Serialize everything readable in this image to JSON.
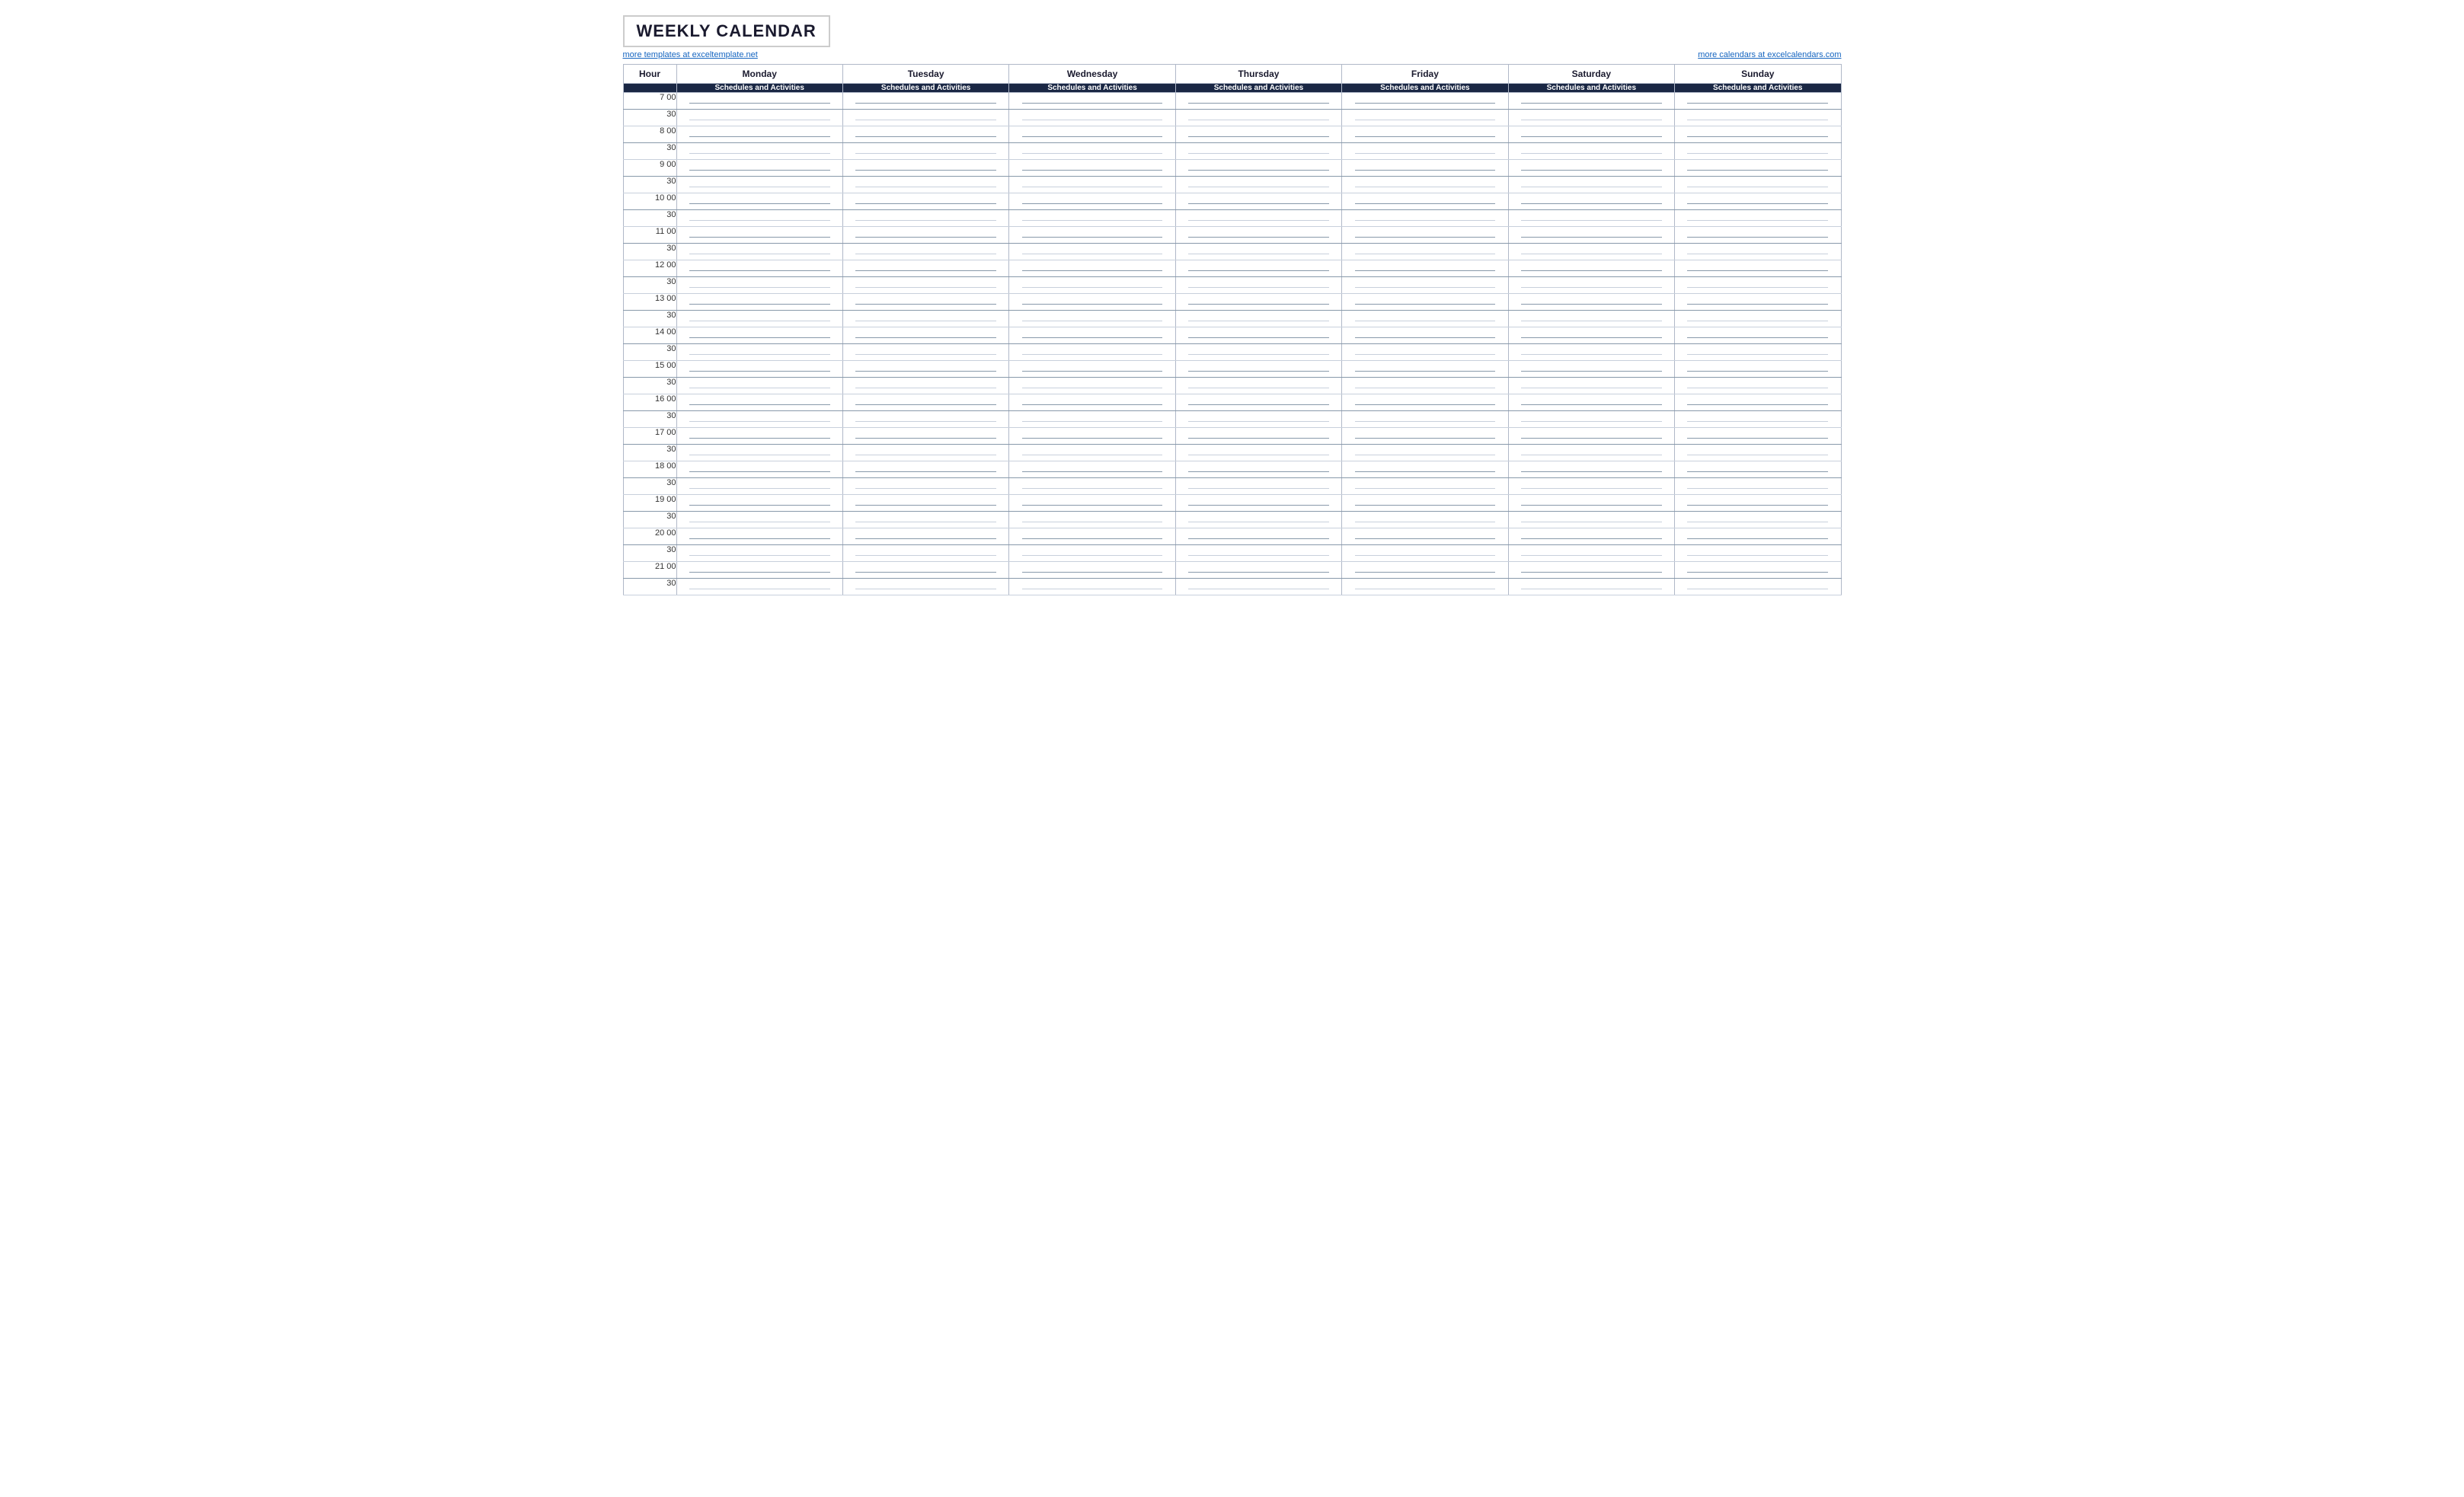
{
  "title": "WEEKLY CALENDAR",
  "link_left": "more templates at exceltemplate.net",
  "link_right": "more calendars at excelcalendars.com",
  "header": {
    "hour_label": "Hour",
    "days": [
      "Monday",
      "Tuesday",
      "Wednesday",
      "Thursday",
      "Friday",
      "Saturday",
      "Sunday"
    ],
    "sub_label": "Schedules and Activities"
  },
  "time_slots": [
    {
      "hour": "7  00",
      "half": "30"
    },
    {
      "hour": "8  00",
      "half": "30"
    },
    {
      "hour": "9  00",
      "half": "30"
    },
    {
      "hour": "10  00",
      "half": "30"
    },
    {
      "hour": "11  00",
      "half": "30"
    },
    {
      "hour": "12  00",
      "half": "30"
    },
    {
      "hour": "13  00",
      "half": "30"
    },
    {
      "hour": "14  00",
      "half": "30"
    },
    {
      "hour": "15  00",
      "half": "30"
    },
    {
      "hour": "16  00",
      "half": "30"
    },
    {
      "hour": "17  00",
      "half": "30"
    },
    {
      "hour": "18  00",
      "half": "30"
    },
    {
      "hour": "19  00",
      "half": "30"
    },
    {
      "hour": "20  00",
      "half": "30"
    },
    {
      "hour": "21  00",
      "half": "30"
    }
  ]
}
